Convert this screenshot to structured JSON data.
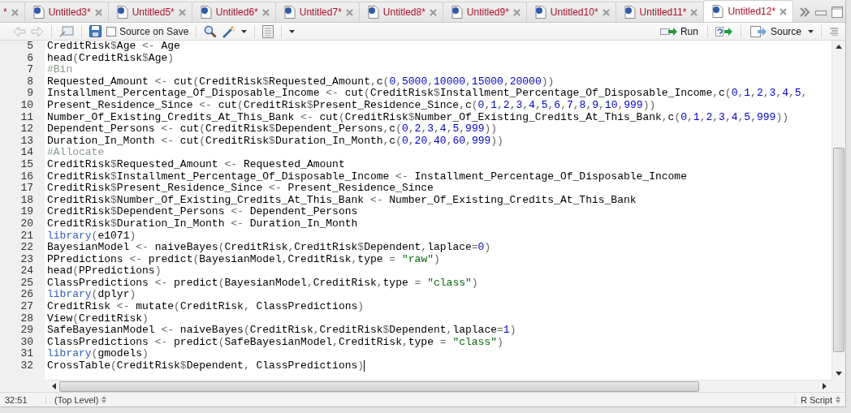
{
  "tabs": [
    {
      "label": "*",
      "selected": false,
      "modified": true,
      "partial": true
    },
    {
      "label": "Untitled3*",
      "selected": false,
      "modified": true,
      "partial": false
    },
    {
      "label": "Untitled5*",
      "selected": false,
      "modified": true,
      "partial": false
    },
    {
      "label": "Untitled6*",
      "selected": false,
      "modified": true,
      "partial": false
    },
    {
      "label": "Untitled7*",
      "selected": false,
      "modified": true,
      "partial": false
    },
    {
      "label": "Untitled8*",
      "selected": false,
      "modified": true,
      "partial": false
    },
    {
      "label": "Untitled9*",
      "selected": false,
      "modified": true,
      "partial": false
    },
    {
      "label": "Untitled10*",
      "selected": false,
      "modified": true,
      "partial": false
    },
    {
      "label": "Untitled11*",
      "selected": false,
      "modified": true,
      "partial": false
    },
    {
      "label": "Untitled12*",
      "selected": true,
      "modified": true,
      "partial": false
    }
  ],
  "toolbar": {
    "source_on_save": {
      "label": "Source on Save",
      "checked": false
    },
    "run": {
      "label": "Run"
    },
    "source": {
      "label": "Source"
    }
  },
  "editor": {
    "lines": [
      {
        "number": "5",
        "text": "CreditRisk$Age <- Age"
      },
      {
        "number": "6",
        "text": "head(CreditRisk$Age)"
      },
      {
        "number": "7",
        "text": "#Bin"
      },
      {
        "number": "8",
        "text": "Requested_Amount <- cut(CreditRisk$Requested_Amount,c(0,5000,10000,15000,20000))"
      },
      {
        "number": "9",
        "text": "Installment_Percentage_Of_Disposable_Income <- cut(CreditRisk$Installment_Percentage_Of_Disposable_Income,c(0,1,2,3,4,5,"
      },
      {
        "number": "10",
        "text": "Present_Residence_Since <- cut(CreditRisk$Present_Residence_Since,c(0,1,2,3,4,5,6,7,8,9,10,999))"
      },
      {
        "number": "11",
        "text": "Number_Of_Existing_Credits_At_This_Bank <- cut(CreditRisk$Number_Of_Existing_Credits_At_This_Bank,c(0,1,2,3,4,5,999))"
      },
      {
        "number": "12",
        "text": "Dependent_Persons <- cut(CreditRisk$Dependent_Persons,c(0,2,3,4,5,999))"
      },
      {
        "number": "13",
        "text": "Duration_In_Month <- cut(CreditRisk$Duration_In_Month,c(0,20,40,60,999))"
      },
      {
        "number": "14",
        "text": "#Allocate"
      },
      {
        "number": "15",
        "text": "CreditRisk$Requested_Amount <- Requested_Amount"
      },
      {
        "number": "16",
        "text": "CreditRisk$Installment_Percentage_Of_Disposable_Income <- Installment_Percentage_Of_Disposable_Income"
      },
      {
        "number": "17",
        "text": "CreditRisk$Present_Residence_Since <- Present_Residence_Since"
      },
      {
        "number": "18",
        "text": "CreditRisk$Number_Of_Existing_Credits_At_This_Bank <- Number_Of_Existing_Credits_At_This_Bank"
      },
      {
        "number": "19",
        "text": "CreditRisk$Dependent_Persons <- Dependent_Persons"
      },
      {
        "number": "20",
        "text": "CreditRisk$Duration_In_Month <- Duration_In_Month"
      },
      {
        "number": "21",
        "keyword": "library",
        "text": "(e1071)"
      },
      {
        "number": "22",
        "text": "BayesianModel <- naiveBayes(CreditRisk,CreditRisk$Dependent,laplace=0)"
      },
      {
        "number": "23",
        "text": "PPredictions <- predict(BayesianModel,CreditRisk,type = \"raw\")"
      },
      {
        "number": "24",
        "text": "head(PPredictions)"
      },
      {
        "number": "25",
        "text": "ClassPredictions <- predict(BayesianModel,CreditRisk,type = \"class\")"
      },
      {
        "number": "26",
        "keyword": "library",
        "text": "(dplyr)"
      },
      {
        "number": "27",
        "text": "CreditRisk <- mutate(CreditRisk, ClassPredictions)"
      },
      {
        "number": "28",
        "text": "View(CreditRisk)"
      },
      {
        "number": "29",
        "text": "SafeBayesianModel <- naiveBayes(CreditRisk,CreditRisk$Dependent,laplace=1)"
      },
      {
        "number": "30",
        "text": "ClassPredictions <- predict(SafeBayesianModel,CreditRisk,type = \"class\")"
      },
      {
        "number": "31",
        "keyword": "library",
        "text": "(gmodels)"
      },
      {
        "number": "32",
        "text": "CrossTable(CreditRisk$Dependent, ClassPredictions)",
        "cursor": true
      }
    ]
  },
  "status_bar": {
    "position": "32:51",
    "scope": "(Top Level)",
    "file_type": "R Script"
  }
}
